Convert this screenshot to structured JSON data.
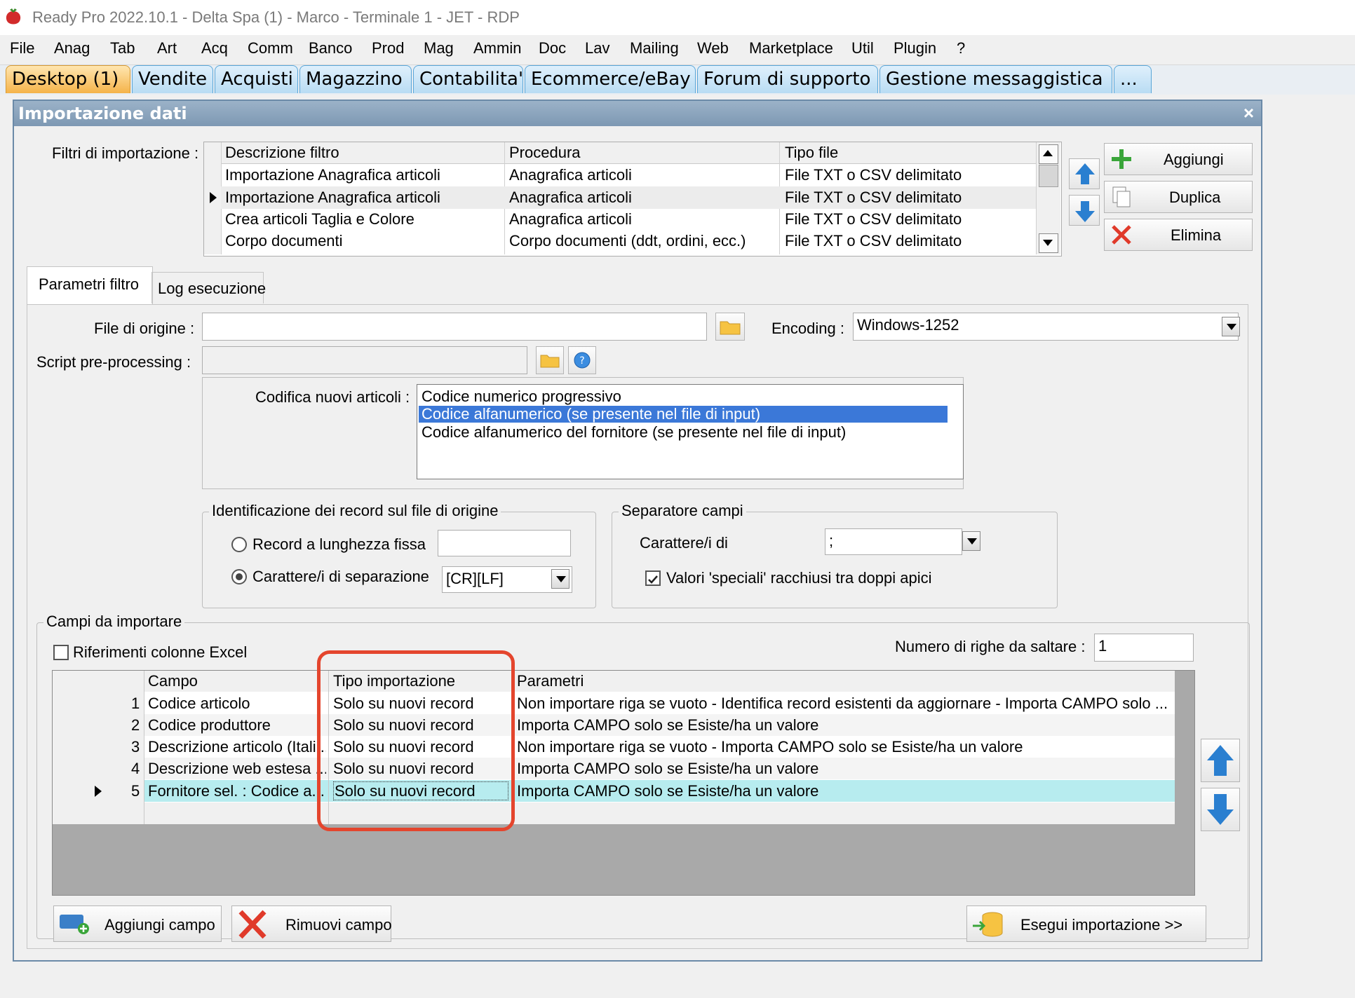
{
  "window": {
    "title": "Ready Pro 2022.10.1 - Delta Spa (1) - Marco - Terminale 1 - JET - RDP"
  },
  "menu": [
    "File",
    "Anag",
    "Tab",
    "Art",
    "Acq",
    "Comm",
    "Banco",
    "Prod",
    "Mag",
    "Ammin",
    "Doc",
    "Lav",
    "Mailing",
    "Web",
    "Marketplace",
    "Util",
    "Plugin",
    "?"
  ],
  "tabs": [
    "Desktop (1)",
    "Vendite",
    "Acquisti",
    "Magazzino",
    "Contabilita'",
    "Ecommerce/eBay",
    "Forum di supporto",
    "Gestione messaggistica",
    "..."
  ],
  "dialog": {
    "title": "Importazione dati",
    "close": "×",
    "filters_label": "Filtri di importazione :",
    "filters_columns": [
      "Descrizione filtro",
      "Procedura",
      "Tipo file"
    ],
    "filters_rows": [
      [
        "Importazione Anagrafica articoli",
        "Anagrafica articoli",
        "File TXT o CSV delimitato"
      ],
      [
        "Importazione Anagrafica articoli",
        "Anagrafica articoli",
        "File TXT o CSV delimitato"
      ],
      [
        "Crea articoli Taglia e Colore",
        "Anagrafica articoli",
        "File TXT o CSV delimitato"
      ],
      [
        "Corpo documenti",
        "Corpo documenti (ddt, ordini, ecc.)",
        "File TXT o CSV delimitato"
      ]
    ],
    "buttons": {
      "add": "Aggiungi",
      "duplicate": "Duplica",
      "delete": "Elimina"
    },
    "subtabs": [
      "Parametri filtro",
      "Log esecuzione"
    ],
    "source_file_label": "File di origine :",
    "source_file_value": "",
    "encoding_label": "Encoding :",
    "encoding_value": "Windows-1252",
    "script_label": "Script pre-processing :",
    "codifica_label": "Codifica nuovi articoli :",
    "codifica_options": [
      "Codice numerico progressivo",
      "Codice alfanumerico (se presente nel file di input)",
      "Codice alfanumerico del fornitore (se presente nel file di input)"
    ],
    "identification": {
      "legend": "Identificazione dei record sul file di origine",
      "fixed_label": "Record a lunghezza fissa",
      "fixed_value": "",
      "sep_label": "Carattere/i di separazione",
      "sep_value": "[CR][LF]"
    },
    "separator": {
      "legend": "Separatore campi",
      "chars_label": "Carattere/i di",
      "chars_value": ";",
      "quotes_label": "Valori 'speciali' racchiusi tra doppi apici"
    },
    "fields": {
      "legend": "Campi da importare",
      "excel_label": "Riferimenti colonne Excel",
      "skip_label": "Numero di righe da saltare :",
      "skip_value": "1",
      "columns": [
        "Campo",
        "Tipo importazione",
        "Parametri"
      ],
      "rows": [
        {
          "n": "1",
          "campo": "Codice articolo",
          "tipo": "Solo su nuovi record",
          "param": "Non importare riga se vuoto - Identifica record esistenti da aggiornare - Importa CAMPO solo ..."
        },
        {
          "n": "2",
          "campo": "Codice produttore",
          "tipo": "Solo su nuovi record",
          "param": "Importa CAMPO solo se Esiste/ha un valore"
        },
        {
          "n": "3",
          "campo": "Descrizione articolo (Itali...",
          "tipo": "Solo su nuovi record",
          "param": "Non importare riga se vuoto - Importa CAMPO solo se Esiste/ha un valore"
        },
        {
          "n": "4",
          "campo": "Descrizione web estesa ...",
          "tipo": "Solo su nuovi record",
          "param": "Importa CAMPO solo se Esiste/ha un valore"
        },
        {
          "n": "5",
          "campo": "Fornitore sel. : Codice a...",
          "tipo": "Solo su nuovi record",
          "param": "Importa CAMPO solo se Esiste/ha un valore"
        }
      ],
      "add_field": "Aggiungi campo",
      "remove_field": "Rimuovi campo",
      "run_import": "Esegui importazione >>"
    }
  },
  "colors": {
    "highlight_annotation": "#e4452d",
    "selected_row": "#b7ecef",
    "list_selection": "#3b78d8",
    "accent_blue": "#2a7fd0"
  }
}
